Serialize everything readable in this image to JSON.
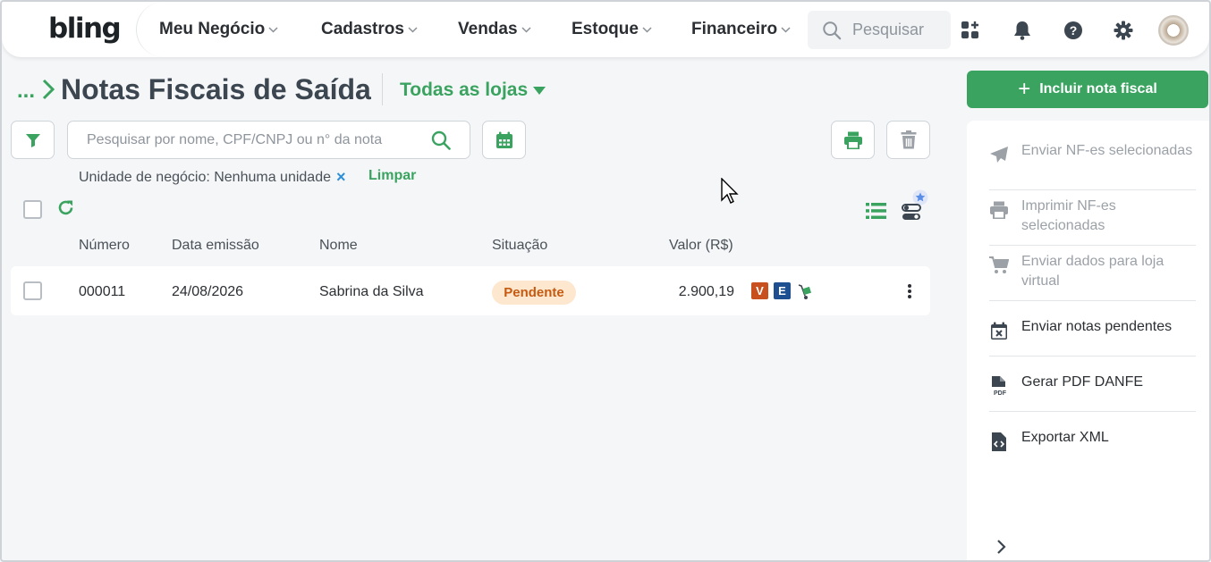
{
  "app": {
    "logo": "bling"
  },
  "nav": [
    {
      "label": "Meu Negócio"
    },
    {
      "label": "Cadastros"
    },
    {
      "label": "Vendas"
    },
    {
      "label": "Estoque"
    },
    {
      "label": "Financeiro"
    }
  ],
  "top_search": {
    "placeholder": "Pesquisar"
  },
  "header": {
    "breadcrumb_dots": "...",
    "title": "Notas Fiscais de Saída",
    "store_selector": "Todas as lojas",
    "primary_button": "Incluir nota fiscal"
  },
  "toolbar": {
    "search_placeholder": "Pesquisar por nome, CPF/CNPJ ou n° da nota"
  },
  "filters": {
    "chip_label": "Unidade de negócio: Nenhuma unidade",
    "chip_remove": "×",
    "clear_label": "Limpar"
  },
  "table": {
    "columns": [
      "Número",
      "Data emissão",
      "Nome",
      "Situação",
      "Valor (R$)"
    ],
    "rows": [
      {
        "numero": "000011",
        "data": "24/08/2026",
        "nome": "Sabrina da Silva",
        "situacao": "Pendente",
        "valor": "2.900,19",
        "tags": [
          "V",
          "E"
        ]
      }
    ]
  },
  "side_panel": {
    "items": [
      {
        "label": "Enviar NF-es selecionadas",
        "icon": "paper-plane-icon",
        "enabled": false
      },
      {
        "label": "Imprimir NF-es selecionadas",
        "icon": "printer-icon",
        "enabled": false
      },
      {
        "label": "Enviar dados para loja virtual",
        "icon": "cart-icon",
        "enabled": false
      },
      {
        "label": "Enviar notas pendentes",
        "icon": "calendar-x-icon",
        "enabled": true
      },
      {
        "label": "Gerar PDF DANFE",
        "icon": "pdf-file-icon",
        "enabled": true
      },
      {
        "label": "Exportar XML",
        "icon": "code-file-icon",
        "enabled": true
      }
    ]
  },
  "colors": {
    "brand_green": "#3aa360",
    "pending_bg": "#fde7cf",
    "pending_text": "#c65a10",
    "tag_v": "#c8501e",
    "tag_e": "#1d4f91",
    "disabled_text": "#9ba1a7"
  }
}
